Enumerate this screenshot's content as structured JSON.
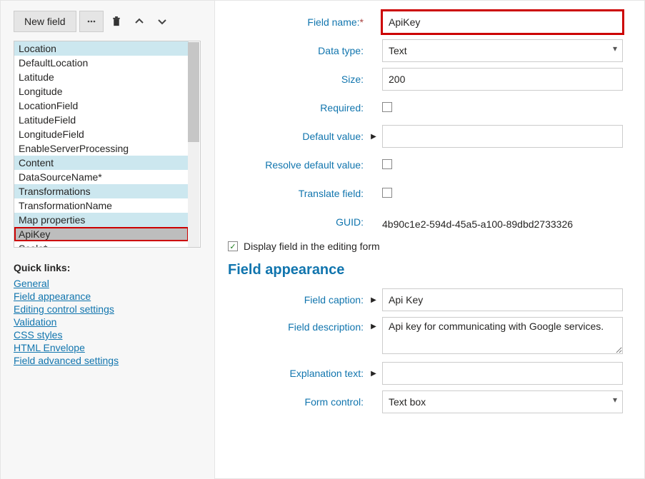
{
  "toolbar": {
    "new_field_label": "New field"
  },
  "field_list": [
    {
      "label": "Location",
      "kind": "category"
    },
    {
      "label": "DefaultLocation",
      "kind": "item"
    },
    {
      "label": "Latitude",
      "kind": "item"
    },
    {
      "label": "Longitude",
      "kind": "item"
    },
    {
      "label": "LocationField",
      "kind": "item"
    },
    {
      "label": "LatitudeField",
      "kind": "item"
    },
    {
      "label": "LongitudeField",
      "kind": "item"
    },
    {
      "label": "EnableServerProcessing",
      "kind": "item"
    },
    {
      "label": "Content",
      "kind": "category"
    },
    {
      "label": "DataSourceName*",
      "kind": "item"
    },
    {
      "label": "Transformations",
      "kind": "category"
    },
    {
      "label": "TransformationName",
      "kind": "item"
    },
    {
      "label": "Map properties",
      "kind": "category"
    },
    {
      "label": "ApiKey",
      "kind": "item",
      "selected": true,
      "highlighted": true
    },
    {
      "label": "Scale*",
      "kind": "item"
    }
  ],
  "quick_links": {
    "title": "Quick links:",
    "items": [
      "General",
      "Field appearance",
      "Editing control settings",
      "Validation",
      "CSS styles",
      "HTML Envelope",
      "Field advanced settings"
    ]
  },
  "general": {
    "field_name_label": "Field name:",
    "field_name_required": "*",
    "field_name_value": "ApiKey",
    "data_type_label": "Data type:",
    "data_type_value": "Text",
    "size_label": "Size:",
    "size_value": "200",
    "required_label": "Required:",
    "required_checked": false,
    "default_value_label": "Default value:",
    "default_value_value": "",
    "resolve_label": "Resolve default value:",
    "resolve_checked": false,
    "translate_label": "Translate field:",
    "translate_checked": false,
    "guid_label": "GUID:",
    "guid_value": "4b90c1e2-594d-45a5-a100-89dbd2733326",
    "display_in_form_label": "Display field in the editing form",
    "display_in_form_checked": true
  },
  "appearance": {
    "heading": "Field appearance",
    "caption_label": "Field caption:",
    "caption_value": "Api Key",
    "description_label": "Field description:",
    "description_value": "Api key for communicating with Google services.",
    "explanation_label": "Explanation text:",
    "explanation_value": "",
    "form_control_label": "Form control:",
    "form_control_value": "Text box"
  }
}
